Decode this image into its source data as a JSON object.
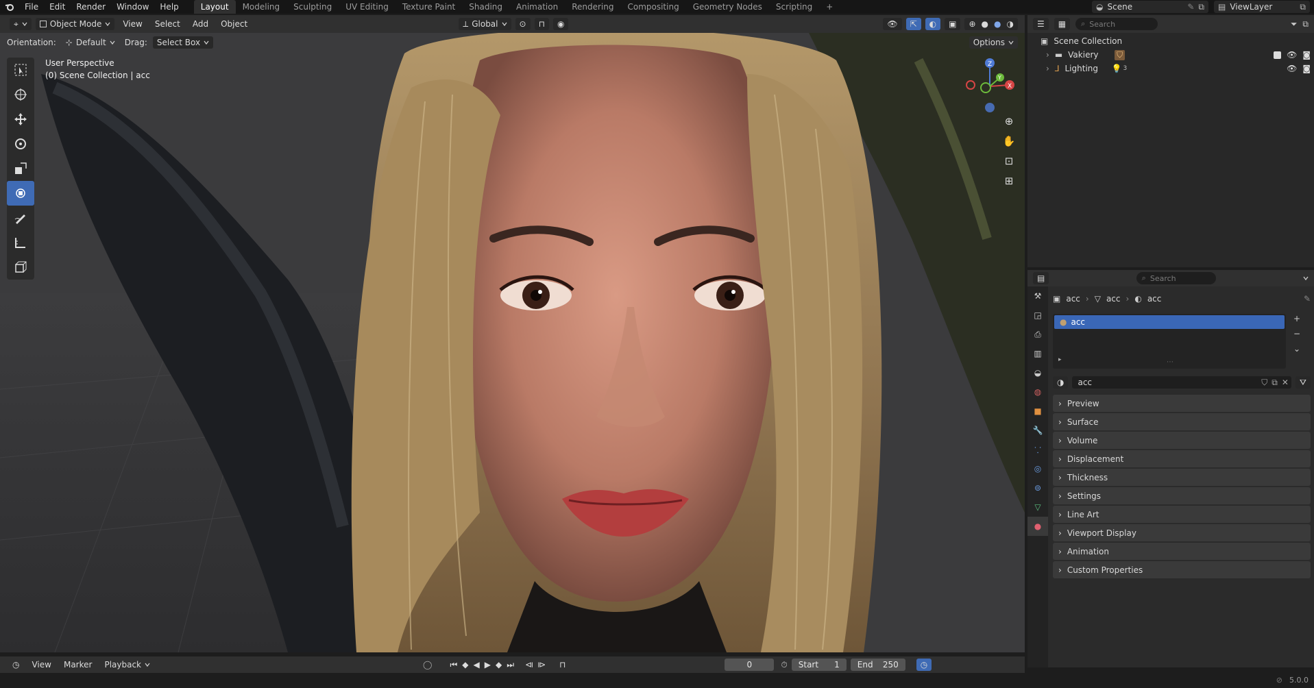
{
  "topbar": {
    "menus": [
      "File",
      "Edit",
      "Render",
      "Window",
      "Help"
    ],
    "workspaces": [
      "Layout",
      "Modeling",
      "Sculpting",
      "UV Editing",
      "Texture Paint",
      "Shading",
      "Animation",
      "Rendering",
      "Compositing",
      "Geometry Nodes",
      "Scripting"
    ],
    "add_tab": "+",
    "scene": "Scene",
    "view_layer": "ViewLayer"
  },
  "viewport_header": {
    "mode": "Object Mode",
    "menus": [
      "View",
      "Select",
      "Add",
      "Object"
    ],
    "transform_orientation": "Global",
    "orientation_label": "Orientation:",
    "orientation_value": "Default",
    "drag_label": "Drag:",
    "drag_value": "Select Box",
    "options": "Options"
  },
  "viewport": {
    "perspective": "User Perspective",
    "collection_info": "(0) Scene Collection | acc",
    "gizmo_axes": [
      "X",
      "Y",
      "Z"
    ]
  },
  "outliner": {
    "search_placeholder": "Search",
    "root": "Scene Collection",
    "items": [
      {
        "label": "Vakiery"
      },
      {
        "label": "Lighting",
        "count": "3"
      }
    ]
  },
  "properties": {
    "search_placeholder": "Search",
    "breadcrumb": [
      "acc",
      "acc",
      "acc"
    ],
    "material_slot": "acc",
    "material_name": "acc",
    "panels": [
      "Preview",
      "Surface",
      "Volume",
      "Displacement",
      "Thickness",
      "Settings",
      "Line Art",
      "Viewport Display",
      "Animation",
      "Custom Properties"
    ]
  },
  "timeline": {
    "menus": [
      "View",
      "Marker",
      "Playback"
    ],
    "current_frame": "0",
    "start_label": "Start",
    "start_value": "1",
    "end_label": "End",
    "end_value": "250"
  },
  "statusbar": {
    "version": "5.0.0"
  },
  "colors": {
    "accent": "#3f6bb5",
    "selected_slot": "#3a67b7"
  }
}
